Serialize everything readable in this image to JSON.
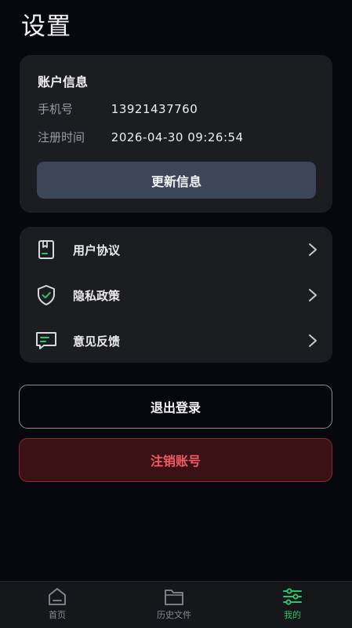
{
  "header": {
    "title": "设置"
  },
  "account": {
    "title": "账户信息",
    "phone_label": "手机号",
    "phone_value": "13921437760",
    "reg_label": "注册时间",
    "reg_value": "2026-04-30 09:26:54",
    "update_label": "更新信息"
  },
  "menu": {
    "items": [
      {
        "label": "用户协议",
        "icon": "document-icon"
      },
      {
        "label": "隐私政策",
        "icon": "shield-check-icon"
      },
      {
        "label": "意见反馈",
        "icon": "chat-bubble-icon"
      }
    ]
  },
  "actions": {
    "logout_label": "退出登录",
    "delete_label": "注销账号"
  },
  "tabbar": {
    "items": [
      {
        "label": "首页",
        "icon": "home-icon"
      },
      {
        "label": "历史文件",
        "icon": "folder-icon"
      },
      {
        "label": "我的",
        "icon": "sliders-icon"
      }
    ],
    "active": "我的",
    "active_color": "#2ec26b"
  },
  "colors": {
    "background": "#07080d",
    "card": "#1c1d21",
    "update_button": "#3c4658",
    "danger_text": "#f05a60",
    "danger_background": "#3a1216"
  }
}
